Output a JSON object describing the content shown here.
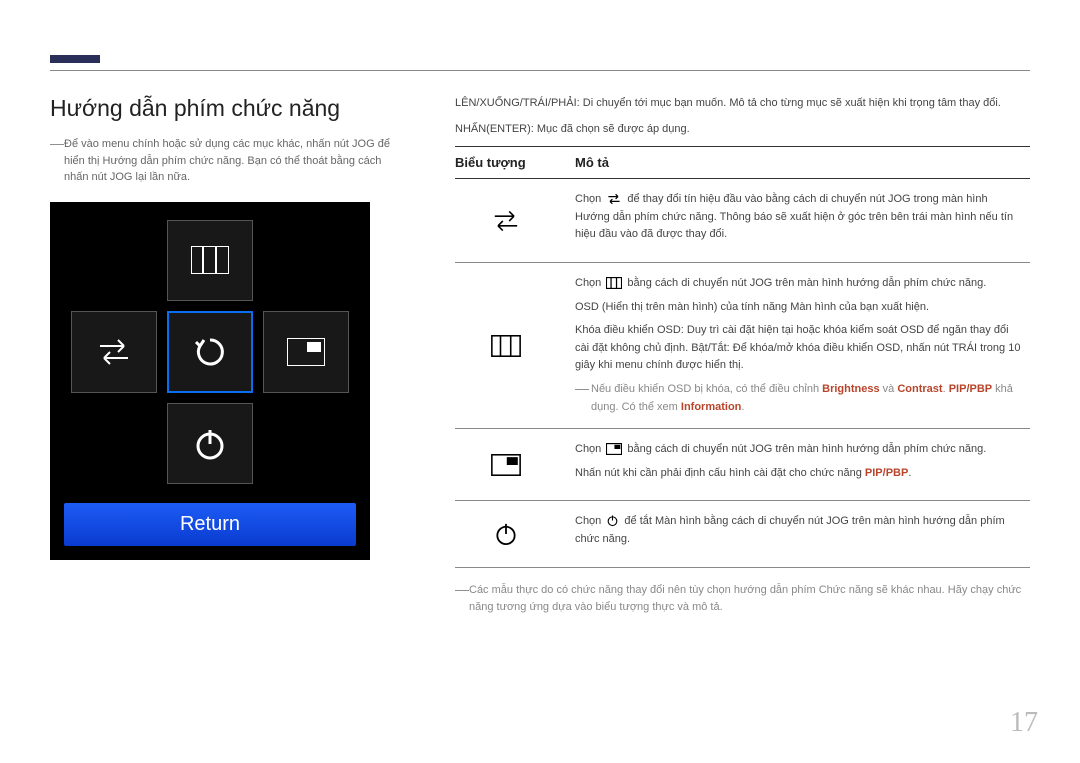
{
  "title": "Hướng dẫn phím chức năng",
  "intro_note": "Để vào menu chính hoặc sử dụng các mục khác, nhấn nút JOG để hiển thị Hướng dẫn phím chức năng. Bạn có thể thoát bằng cách nhấn nút JOG lại lần nữa.",
  "return_label": "Return",
  "right_intro_1": "LÊN/XUỐNG/TRÁI/PHẢI: Di chuyển tới mục bạn muốn. Mô tả cho từng mục sẽ xuất hiện khi trọng tâm thay đổi.",
  "right_intro_2": "NHẤN(ENTER): Mục đã chọn sẽ được áp dụng.",
  "col_icon": "Biểu tượng",
  "col_desc": "Mô tả",
  "row1_pre": "Chọn ",
  "row1_post": " để thay đổi tín hiệu đầu vào bằng cách di chuyển nút JOG trong màn hình Hướng dẫn phím chức năng. Thông báo sẽ xuất hiện ở góc trên bên trái màn hình nếu tín hiệu đầu vào đã được thay đổi.",
  "row2_p1_pre": "Chọn ",
  "row2_p1_post": " bằng cách di chuyển nút JOG trên màn hình hướng dẫn phím chức năng.",
  "row2_p2": "OSD (Hiển thị trên màn hình) của tính năng Màn hình của bạn xuất hiện.",
  "row2_p3": "Khóa điều khiển OSD: Duy trì cài đặt hiện tại hoặc khóa kiểm soát OSD để ngăn thay đổi cài đặt không chủ định. Bật/Tắt: Để khóa/mở khóa điều khiển OSD, nhấn nút TRÁI trong 10 giây khi menu chính được hiển thị.",
  "row2_note_a": "Nếu điều khiển OSD bị khóa, có thể điều chỉnh ",
  "row2_note_b": " và ",
  "row2_note_c": " khả dụng. Có thể xem ",
  "row2_note_dot": ".",
  "term_brightness": "Brightness",
  "term_contrast": "Contrast",
  "term_pippbp": "PIP/PBP",
  "term_information": "Information",
  "row3_p1_pre": "Chọn ",
  "row3_p1_post": " bằng cách di chuyển nút JOG trên màn hình hướng dẫn phím chức năng.",
  "row3_p2_pre": "Nhấn nút khi cần phải định cấu hình cài đặt cho chức năng ",
  "row3_p2_dot": ".",
  "row4_pre": "Chọn ",
  "row4_post": " để tắt Màn hình bằng cách di chuyển nút JOG trên màn hình hướng dẫn phím chức năng.",
  "footer_note": "Các mẫu thực do có chức năng thay đổi nên tùy chọn hướng dẫn phím Chức năng sẽ khác nhau. Hãy chạy chức năng tương ứng dựa vào biểu tượng thực và mô tả.",
  "page_number": "17"
}
